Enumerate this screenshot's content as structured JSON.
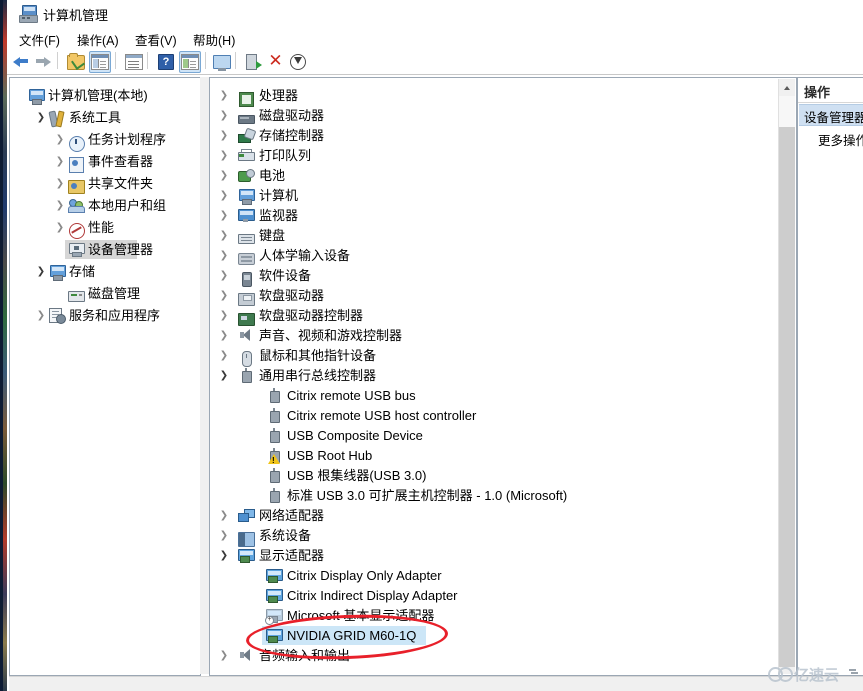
{
  "window": {
    "title": "计算机管理",
    "icon": "computer-management-icon"
  },
  "menu": [
    {
      "label": "文件(F)",
      "name": "menu-file"
    },
    {
      "label": "操作(A)",
      "name": "menu-action"
    },
    {
      "label": "查看(V)",
      "name": "menu-view"
    },
    {
      "label": "帮助(H)",
      "name": "menu-help"
    }
  ],
  "toolbar": [
    {
      "name": "back-button",
      "icon": "arrow-back-icon"
    },
    {
      "name": "forward-button",
      "icon": "arrow-forward-icon"
    },
    {
      "name": "up-folder-button",
      "icon": "folder-up-icon"
    },
    {
      "name": "show-hide-tree-button",
      "icon": "show-tree-icon"
    },
    {
      "name": "properties-button",
      "icon": "properties-icon"
    },
    {
      "name": "help-button",
      "icon": "help-icon"
    },
    {
      "name": "view-list-button",
      "icon": "list-view-icon"
    },
    {
      "name": "console-button",
      "icon": "monitor-icon"
    },
    {
      "name": "scan-hardware-button",
      "icon": "scan-hardware-icon"
    },
    {
      "name": "uninstall-device-button",
      "icon": "close-x-icon"
    },
    {
      "name": "update-driver-button",
      "icon": "download-circle-icon"
    }
  ],
  "tree": {
    "items": [
      {
        "label": "计算机管理(本地)",
        "indent": 0,
        "chevron": "none",
        "icon": "computer-icon",
        "selected": false
      },
      {
        "label": "系统工具",
        "indent": 1,
        "chevron": "expanded",
        "icon": "system-tools-icon",
        "selected": false
      },
      {
        "label": "任务计划程序",
        "indent": 2,
        "chevron": "collapsed",
        "icon": "task-scheduler-icon",
        "selected": false
      },
      {
        "label": "事件查看器",
        "indent": 2,
        "chevron": "collapsed",
        "icon": "event-viewer-icon",
        "selected": false
      },
      {
        "label": "共享文件夹",
        "indent": 2,
        "chevron": "collapsed",
        "icon": "shared-folders-icon",
        "selected": false
      },
      {
        "label": "本地用户和组",
        "indent": 2,
        "chevron": "collapsed",
        "icon": "local-users-icon",
        "selected": false
      },
      {
        "label": "性能",
        "indent": 2,
        "chevron": "collapsed",
        "icon": "performance-icon",
        "selected": false
      },
      {
        "label": "设备管理器",
        "indent": 2,
        "chevron": "none",
        "icon": "device-manager-icon",
        "selected": true
      },
      {
        "label": "存储",
        "indent": 1,
        "chevron": "expanded",
        "icon": "storage-icon",
        "selected": false
      },
      {
        "label": "磁盘管理",
        "indent": 2,
        "chevron": "none",
        "icon": "disk-management-icon",
        "selected": false
      },
      {
        "label": "服务和应用程序",
        "indent": 1,
        "chevron": "collapsed",
        "icon": "services-apps-icon",
        "selected": false
      }
    ]
  },
  "devices": {
    "items": [
      {
        "label": "处理器",
        "indent": 1,
        "chevron": "collapsed",
        "icon": "cpu-icon"
      },
      {
        "label": "磁盘驱动器",
        "indent": 1,
        "chevron": "collapsed",
        "icon": "disk-drive-icon"
      },
      {
        "label": "存储控制器",
        "indent": 1,
        "chevron": "collapsed",
        "icon": "storage-controller-icon"
      },
      {
        "label": "打印队列",
        "indent": 1,
        "chevron": "collapsed",
        "icon": "print-queue-icon"
      },
      {
        "label": "电池",
        "indent": 1,
        "chevron": "collapsed",
        "icon": "battery-icon"
      },
      {
        "label": "计算机",
        "indent": 1,
        "chevron": "collapsed",
        "icon": "computer-icon"
      },
      {
        "label": "监视器",
        "indent": 1,
        "chevron": "collapsed",
        "icon": "monitor-icon"
      },
      {
        "label": "键盘",
        "indent": 1,
        "chevron": "collapsed",
        "icon": "keyboard-icon"
      },
      {
        "label": "人体学输入设备",
        "indent": 1,
        "chevron": "collapsed",
        "icon": "hid-icon"
      },
      {
        "label": "软件设备",
        "indent": 1,
        "chevron": "collapsed",
        "icon": "software-device-icon"
      },
      {
        "label": "软盘驱动器",
        "indent": 1,
        "chevron": "collapsed",
        "icon": "floppy-drive-icon"
      },
      {
        "label": "软盘驱动器控制器",
        "indent": 1,
        "chevron": "collapsed",
        "icon": "floppy-controller-icon"
      },
      {
        "label": "声音、视频和游戏控制器",
        "indent": 1,
        "chevron": "collapsed",
        "icon": "sound-video-game-icon"
      },
      {
        "label": "鼠标和其他指针设备",
        "indent": 1,
        "chevron": "collapsed",
        "icon": "mouse-icon"
      },
      {
        "label": "通用串行总线控制器",
        "indent": 1,
        "chevron": "expanded",
        "icon": "usb-icon"
      },
      {
        "label": "Citrix remote USB bus",
        "indent": 2,
        "chevron": "none",
        "icon": "usb-icon"
      },
      {
        "label": "Citrix remote USB host controller",
        "indent": 2,
        "chevron": "none",
        "icon": "usb-icon"
      },
      {
        "label": "USB Composite Device",
        "indent": 2,
        "chevron": "none",
        "icon": "usb-icon"
      },
      {
        "label": "USB Root Hub",
        "indent": 2,
        "chevron": "none",
        "icon": "usb-warning-icon"
      },
      {
        "label": "USB 根集线器(USB 3.0)",
        "indent": 2,
        "chevron": "none",
        "icon": "usb-icon"
      },
      {
        "label": "标准 USB 3.0 可扩展主机控制器 - 1.0 (Microsoft)",
        "indent": 2,
        "chevron": "none",
        "icon": "usb-icon"
      },
      {
        "label": "网络适配器",
        "indent": 1,
        "chevron": "collapsed",
        "icon": "network-adapter-icon"
      },
      {
        "label": "系统设备",
        "indent": 1,
        "chevron": "collapsed",
        "icon": "system-device-icon"
      },
      {
        "label": "显示适配器",
        "indent": 1,
        "chevron": "expanded",
        "icon": "display-adapter-icon"
      },
      {
        "label": "Citrix Display Only Adapter",
        "indent": 2,
        "chevron": "none",
        "icon": "display-adapter-icon"
      },
      {
        "label": "Citrix Indirect Display Adapter",
        "indent": 2,
        "chevron": "none",
        "icon": "display-adapter-icon"
      },
      {
        "label": "Microsoft 基本显示适配器",
        "indent": 2,
        "chevron": "none",
        "icon": "display-adapter-disabled-icon"
      },
      {
        "label": "NVIDIA GRID M60-1Q",
        "indent": 2,
        "chevron": "none",
        "icon": "display-adapter-icon",
        "selected": true
      },
      {
        "label": "音频输入和输出",
        "indent": 1,
        "chevron": "collapsed",
        "icon": "audio-io-icon"
      }
    ]
  },
  "actions_pane": {
    "title": "操作",
    "selected_item": "设备管理器",
    "more_actions": "更多操作"
  },
  "annotation": {
    "target": "NVIDIA GRID M60-1Q",
    "shape": "ellipse",
    "color": "#e8202a"
  },
  "watermark": {
    "text": "亿速云"
  },
  "colors": {
    "selection_blue": "#cce6f7",
    "selection_gray": "#d6d6d6",
    "annotation_red": "#e8202a"
  }
}
